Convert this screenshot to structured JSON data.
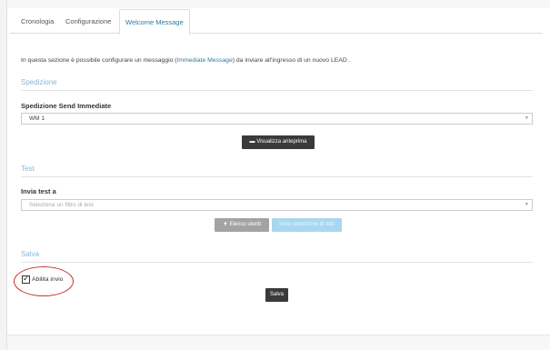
{
  "tabs": [
    {
      "label": "Cronologia"
    },
    {
      "label": "Configurazione"
    },
    {
      "label": "Welcome Message"
    }
  ],
  "intro": {
    "before": "In questa sezione è possibile configurare un messaggio (",
    "link": "Immediate Message",
    "after": ") da inviare all'ingresso di un nuovo LEAD ."
  },
  "spedizione": {
    "title": "Spedizione",
    "field_label": "Spedizione Send Immediate",
    "selected": "WM 1",
    "preview_button": "Visualizza anteprima"
  },
  "test": {
    "title": "Test",
    "field_label": "Invia test a",
    "placeholder": "Seleziona un filtro di test",
    "users_button": "Elenco utenti",
    "send_button": "Invia spedizione di test"
  },
  "salva": {
    "title": "Salva",
    "enable_label": "Abilita invio",
    "enabled": true,
    "save_button": "Salva"
  },
  "colors": {
    "accent": "#2b7aa8",
    "section_title": "#87b7d6",
    "dark_button": "#3a3a3a",
    "highlight_circle": "#c9302c"
  }
}
